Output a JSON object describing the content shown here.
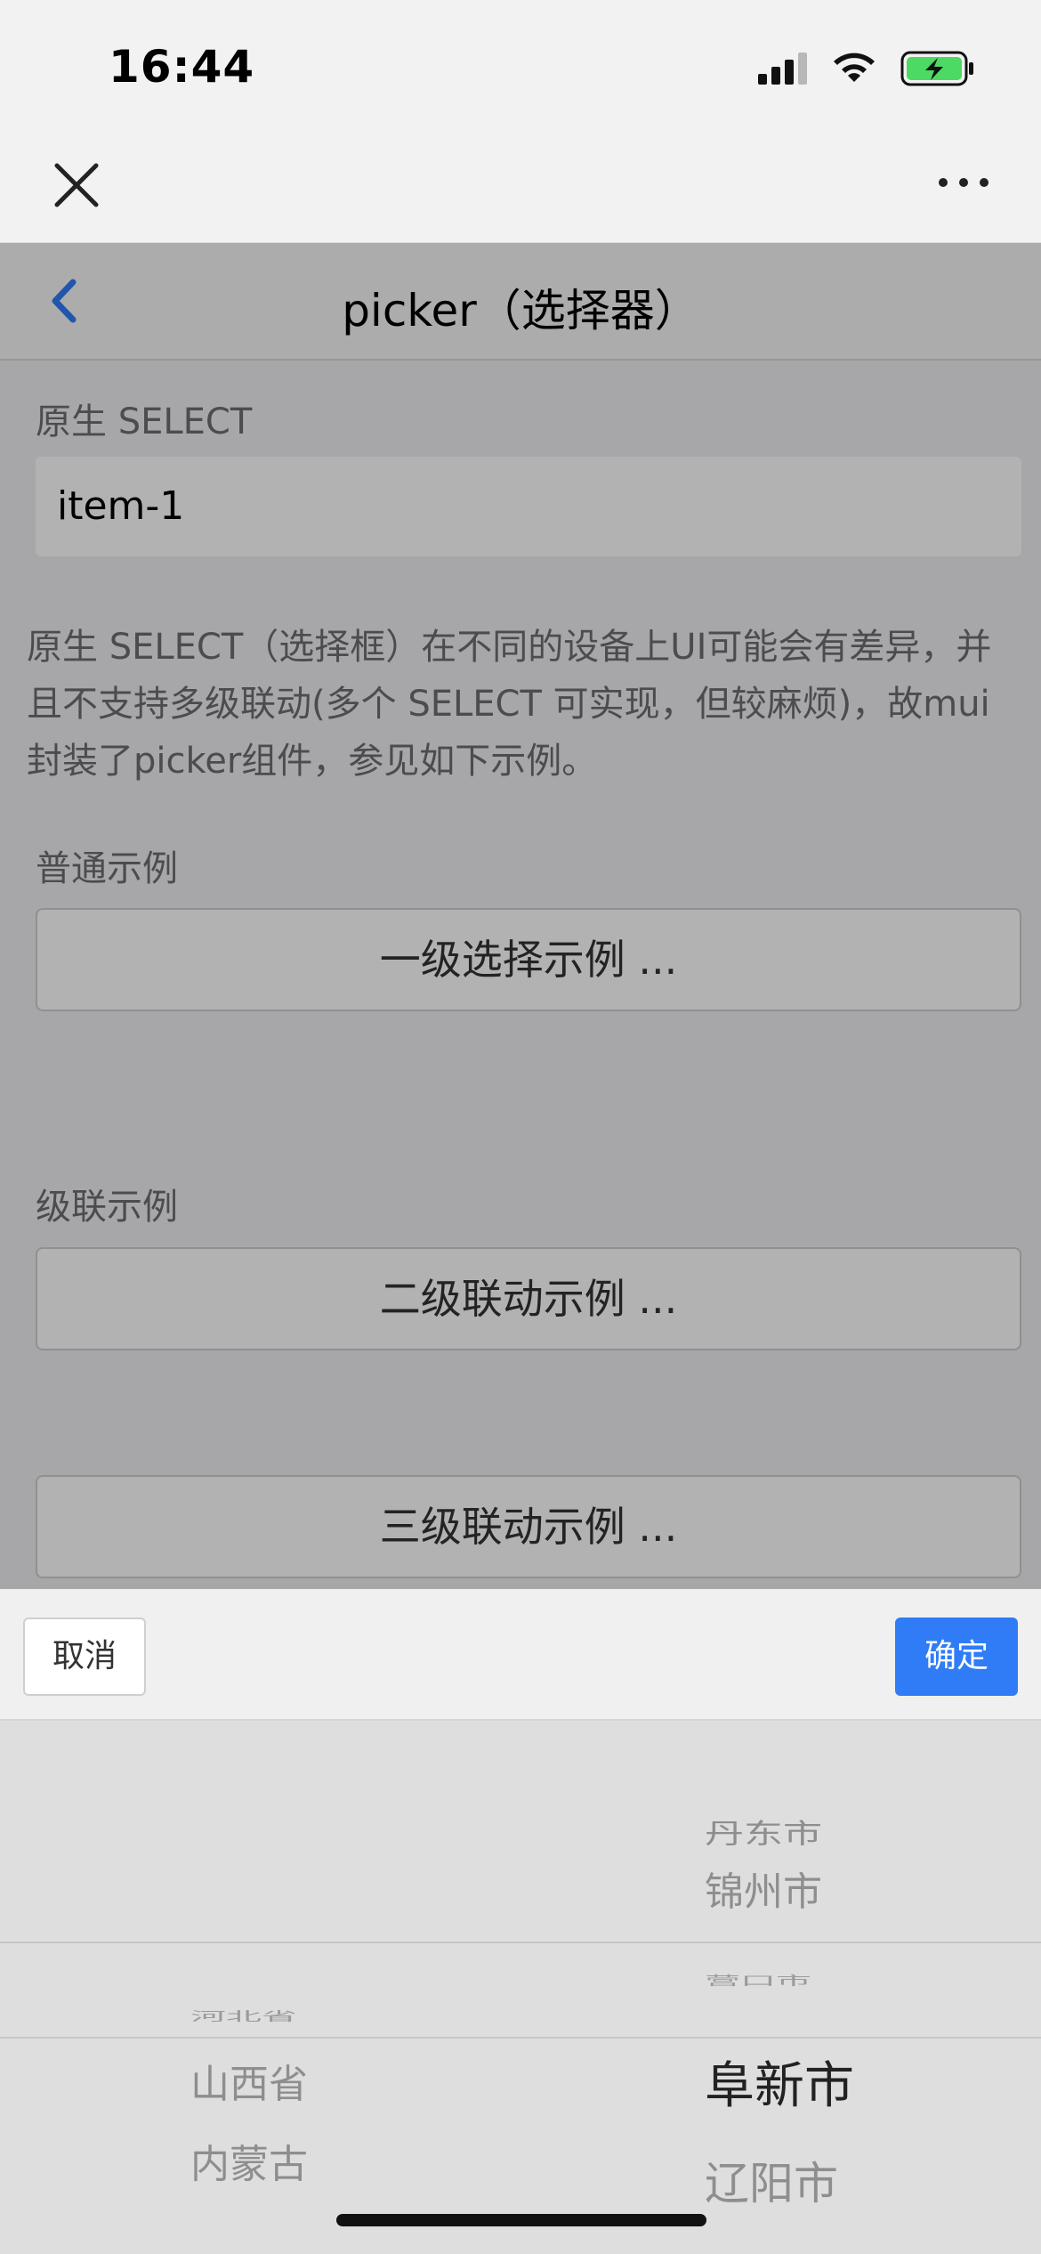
{
  "status_bar": {
    "time": "16:44",
    "icons": [
      "signal-icon",
      "wifi-icon",
      "battery-charging-icon"
    ]
  },
  "mini_program_bar": {
    "icons": [
      "close-icon",
      "more-icon"
    ]
  },
  "header": {
    "title": "picker（选择器）",
    "back_icon": "chevron-left-icon"
  },
  "content": {
    "native_select_label": "原生 SELECT",
    "native_select_value": "item-1",
    "description": "原生 SELECT（选择框）在不同的设备上UI可能会有差异，并且不支持多级联动(多个 SELECT 可实现，但较麻烦)，故mui封装了picker组件，参见如下示例。",
    "normal_section_label": "普通示例",
    "one_level_button": "一级选择示例 ...",
    "cascade_section_label": "级联示例",
    "two_level_button": "二级联动示例 ...",
    "three_level_button": "三级联动示例 ..."
  },
  "picker": {
    "cancel_label": "取消",
    "confirm_label": "确定",
    "col1": {
      "items": [
        "河北省",
        "山西省",
        "内蒙古"
      ],
      "selected": ""
    },
    "col2": {
      "items": [
        "丹东市",
        "锦州市",
        "营口市"
      ],
      "selected": "阜新市",
      "after": "辽阳市"
    }
  },
  "colors": {
    "accent": "#2f7cf6",
    "back_icon": "#2f7cf6",
    "battery": "#4cd964"
  }
}
